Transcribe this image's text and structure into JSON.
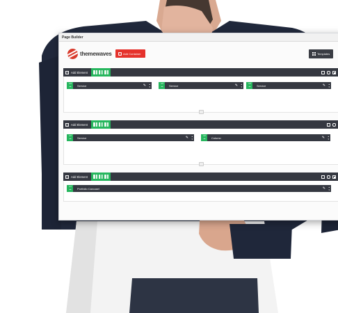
{
  "board": {
    "title": "Page Builder"
  },
  "header": {
    "logo_name": "themewaves",
    "add_container_label": "Add Container",
    "templates_label": "Templates"
  },
  "sections": [
    {
      "add_element_label": "Add Element",
      "elements": [
        {
          "size": "1/3",
          "label": "Service"
        },
        {
          "size": "1/3",
          "label": "Service"
        },
        {
          "size": "1/3",
          "label": "Service"
        }
      ]
    },
    {
      "add_element_label": "Add Element",
      "elements": [
        {
          "size": "1/2",
          "label": "Service"
        },
        {
          "size": "1/2",
          "label": "Column"
        }
      ]
    },
    {
      "add_element_label": "Add Element",
      "elements": [
        {
          "size": "1/1",
          "label": "Portfolio Carousel"
        }
      ]
    }
  ],
  "icons": {
    "edit": "pencil-icon",
    "reorder": "up-down-arrows-icon",
    "resize": "left-right-arrows-icon"
  },
  "colors": {
    "accent_green": "#27b65e",
    "accent_red": "#e5322c",
    "bar_dark": "#353841"
  }
}
